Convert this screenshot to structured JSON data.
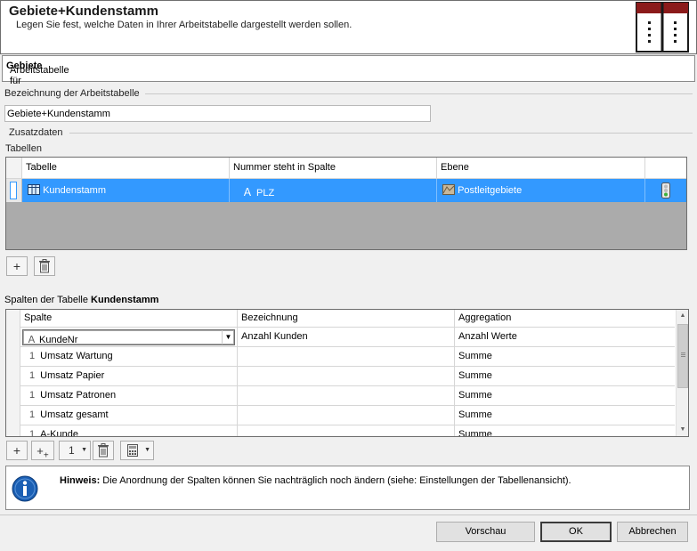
{
  "header": {
    "title": "Gebiete+Kundenstamm",
    "subtitle": "Legen Sie fest, welche Daten in Ihrer Arbeitstabelle dargestellt werden sollen."
  },
  "section": {
    "prefix": "Arbeitstabelle für",
    "name": "Gebiete"
  },
  "name_group": {
    "label": "Bezeichnung der Arbeitstabelle",
    "value": "Gebiete+Kundenstamm"
  },
  "extra_label": "Zusatzdaten",
  "tables": {
    "label": "Tabellen",
    "headers": [
      "Tabelle",
      "Nummer steht in Spalte",
      "Ebene"
    ],
    "row": {
      "table": "Kundenstamm",
      "column": "PLZ",
      "level": "Postleitgebiete"
    }
  },
  "columns_section": {
    "prefix": "Spalten der Tabelle",
    "name": "Kundenstamm"
  },
  "columns": {
    "headers": [
      "Spalte",
      "Bezeichnung",
      "Aggregation"
    ],
    "rows": [
      {
        "spalte": "KundeNr",
        "bezeichnung": "Anzahl Kunden",
        "aggregation": "Anzahl Werte"
      },
      {
        "spalte": "Umsatz Wartung",
        "bezeichnung": "",
        "aggregation": "Summe"
      },
      {
        "spalte": "Umsatz Papier",
        "bezeichnung": "",
        "aggregation": "Summe"
      },
      {
        "spalte": "Umsatz Patronen",
        "bezeichnung": "",
        "aggregation": "Summe"
      },
      {
        "spalte": "Umsatz gesamt",
        "bezeichnung": "",
        "aggregation": "Summe"
      },
      {
        "spalte": "A-Kunde",
        "bezeichnung": "",
        "aggregation": "Summe"
      }
    ]
  },
  "toolbar": {
    "number_value": "1"
  },
  "hint": {
    "label": "Hinweis:",
    "text": "Die Anordnung der Spalten können Sie nachträglich noch ändern (siehe: Einstellungen der Tabellenansicht)."
  },
  "buttons": {
    "preview": "Vorschau",
    "ok": "OK",
    "cancel": "Abbrechen"
  },
  "colors": {
    "selection": "#3399ff",
    "logo_red": "#8b1a1a",
    "info_blue": "#1a5fb4"
  }
}
